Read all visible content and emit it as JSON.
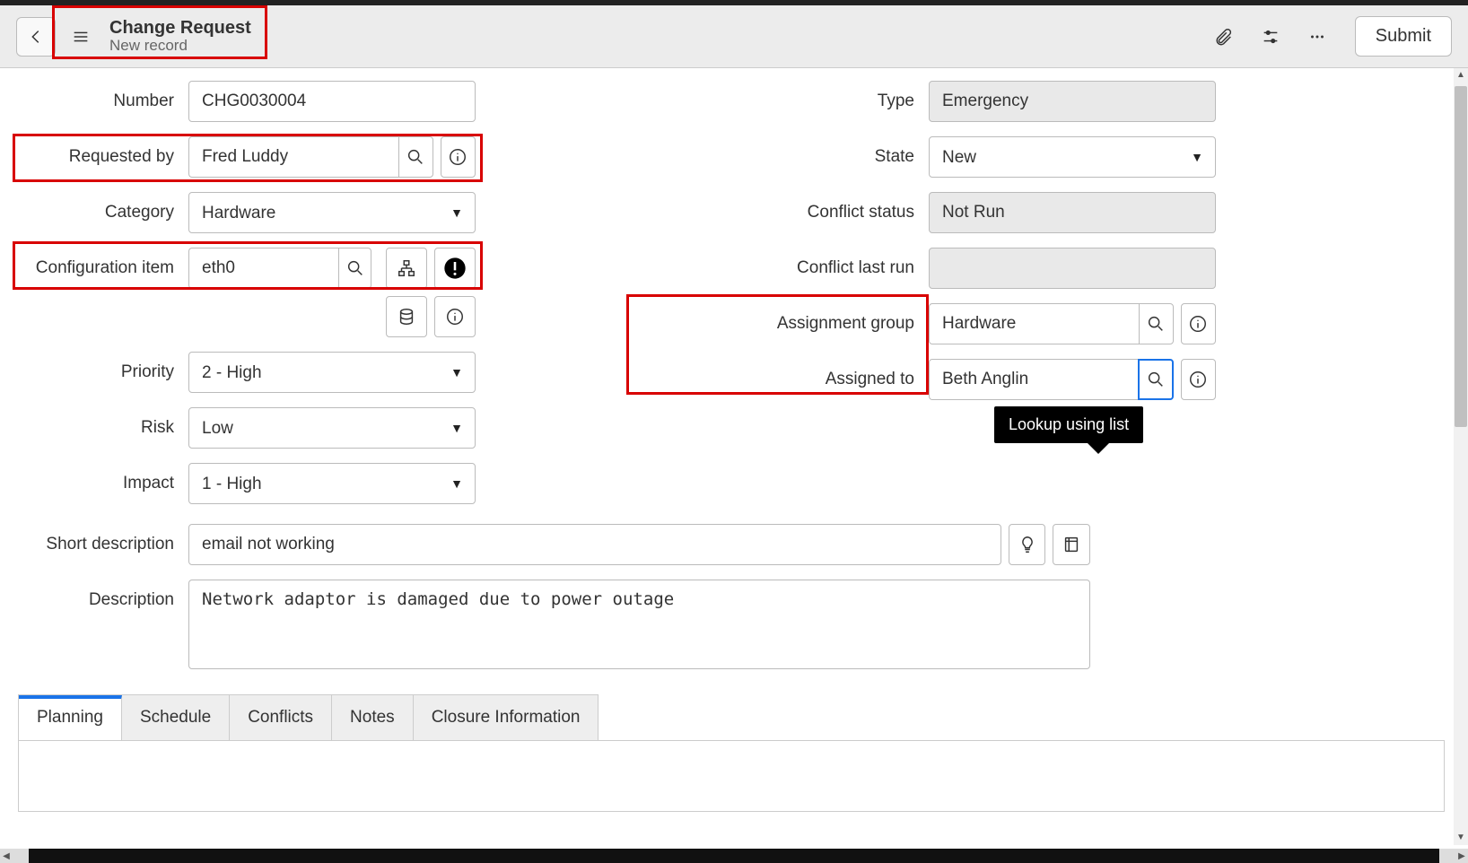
{
  "header": {
    "title": "Change Request",
    "subtitle": "New record",
    "submit_label": "Submit"
  },
  "tooltip": {
    "text": "Lookup using list"
  },
  "left": {
    "number": {
      "label": "Number",
      "value": "CHG0030004"
    },
    "requested_by": {
      "label": "Requested by",
      "value": "Fred Luddy"
    },
    "category": {
      "label": "Category",
      "value": "Hardware"
    },
    "ci": {
      "label": "Configuration item",
      "value": "eth0"
    },
    "priority": {
      "label": "Priority",
      "value": "2 - High"
    },
    "risk": {
      "label": "Risk",
      "value": "Low"
    },
    "impact": {
      "label": "Impact",
      "value": "1 - High"
    }
  },
  "right": {
    "type": {
      "label": "Type",
      "value": "Emergency"
    },
    "state": {
      "label": "State",
      "value": "New"
    },
    "conflict_status": {
      "label": "Conflict status",
      "value": "Not Run"
    },
    "conflict_last": {
      "label": "Conflict last run",
      "value": ""
    },
    "assign_group": {
      "label": "Assignment group",
      "value": "Hardware"
    },
    "assigned_to": {
      "label": "Assigned to",
      "value": "Beth Anglin"
    }
  },
  "full": {
    "short_desc": {
      "label": "Short description",
      "value": "email not working"
    },
    "desc": {
      "label": "Description",
      "value": "Network adaptor is damaged due to power outage"
    }
  },
  "tabs": {
    "planning": "Planning",
    "schedule": "Schedule",
    "conflicts": "Conflicts",
    "notes": "Notes",
    "closure": "Closure Information"
  }
}
